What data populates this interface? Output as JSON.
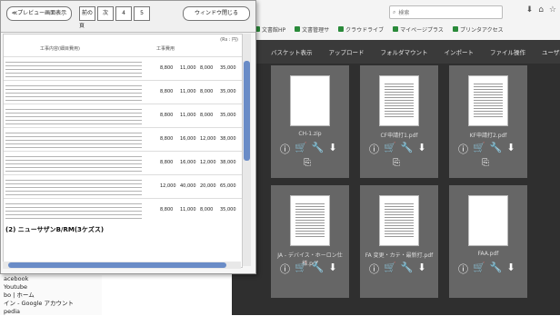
{
  "popup": {
    "close_preview_label": "≪プレビュー画面表示",
    "prev_label": "前の",
    "next_label": "次",
    "page_label": "頁",
    "page_current": "4",
    "page_total": "5",
    "close_window_label": "ウィンドウ閉じる",
    "sheet": {
      "unit_label": "(Rs : 円)",
      "col_header": "工事内容(細目費用)",
      "col_unit": "工事費用",
      "banner": "(2) ニューサザンB/RM(3ケズス)",
      "rows": [
        {
          "a": "8,800",
          "b": "11,000",
          "c": "8,000",
          "d": "35,000"
        },
        {
          "a": "8,800",
          "b": "11,000",
          "c": "8,000",
          "d": "35,000"
        },
        {
          "a": "8,800",
          "b": "11,000",
          "c": "8,000",
          "d": "35,000"
        },
        {
          "a": "8,800",
          "b": "16,000",
          "c": "12,000",
          "d": "38,000"
        },
        {
          "a": "8,800",
          "b": "16,000",
          "c": "12,000",
          "d": "38,000"
        },
        {
          "a": "12,000",
          "b": "40,000",
          "c": "20,000",
          "d": "65,000"
        },
        {
          "a": "8,800",
          "b": "11,000",
          "c": "8,000",
          "d": "35,000"
        }
      ]
    }
  },
  "browser": {
    "url_placeholder": "検索",
    "bookmarks": [
      "文書館HP",
      "文書管理サ",
      "クラウドライブ",
      "マイページプラス",
      "プリンタアクセス"
    ]
  },
  "app": {
    "menu": [
      "バスケット表示",
      "アップロード",
      "フォルダマウント",
      "インポート",
      "ファイル操作",
      "ユーザ設定"
    ],
    "tiles": [
      {
        "name": "CH-1.zip",
        "doc": false
      },
      {
        "name": "CF申請打1.pdf",
        "doc": true
      },
      {
        "name": "KF申請打2.pdf",
        "doc": true
      },
      {
        "name": "JA - デバイス・ホーロン仕様.pdf",
        "doc": true
      },
      {
        "name": "FA 変更・カテ・最新打.pdf",
        "doc": true
      },
      {
        "name": "FAA.pdf",
        "doc": false
      }
    ]
  },
  "sidebar": {
    "items": [
      "acebook",
      "Youtube",
      "bo | ホーム",
      "イン - Google アカウント",
      "pedia"
    ]
  }
}
